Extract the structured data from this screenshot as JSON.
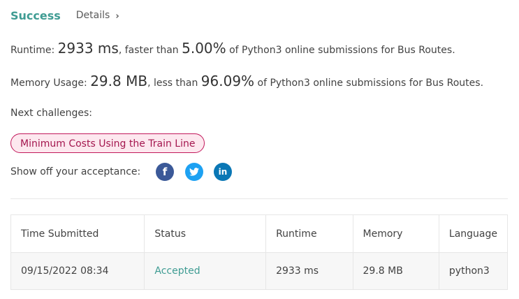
{
  "header": {
    "title": "Success",
    "details_label": "Details",
    "details_chevron": "›"
  },
  "runtime": {
    "label": "Runtime:",
    "value": "2933 ms",
    "comparison": ", faster than",
    "percent": "5.00%",
    "suffix": "of Python3 online submissions for Bus Routes."
  },
  "memory": {
    "label": "Memory Usage:",
    "value": "29.8 MB",
    "comparison": ", less than",
    "percent": "96.09%",
    "suffix": "of Python3 online submissions for Bus Routes."
  },
  "next_challenges": {
    "label": "Next challenges:",
    "items": [
      "Minimum Costs Using the Train Line"
    ]
  },
  "share": {
    "label": "Show off your acceptance:",
    "facebook_glyph": "f",
    "linkedin_glyph": "in",
    "icons": [
      "facebook-icon",
      "twitter-icon",
      "linkedin-icon"
    ]
  },
  "table": {
    "headers": [
      "Time Submitted",
      "Status",
      "Runtime",
      "Memory",
      "Language"
    ],
    "rows": [
      [
        "09/15/2022 08:34",
        "Accepted",
        "2933 ms",
        "29.8 MB",
        "python3"
      ]
    ]
  },
  "colors": {
    "accent": "#3f9c93",
    "challenge_border": "#c2185b",
    "challenge_bg": "#fde8ef",
    "facebook": "#3b5998",
    "twitter": "#1da1f2",
    "linkedin": "#0a77b5"
  }
}
